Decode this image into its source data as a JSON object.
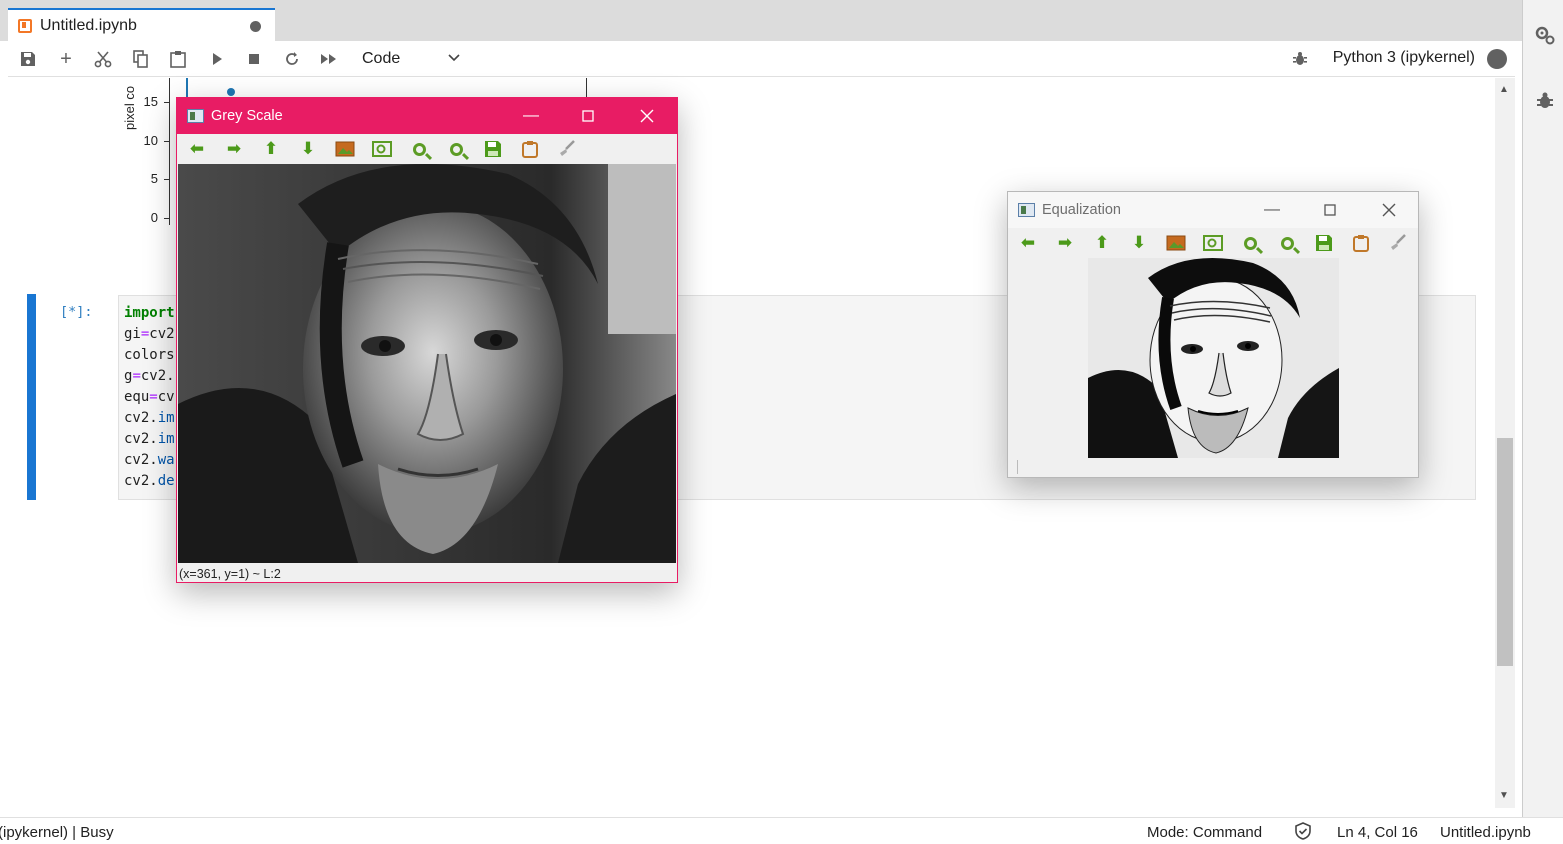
{
  "tab": {
    "title": "Untitled.ipynb"
  },
  "toolbar": {
    "cell_type": "Code",
    "kernel": "Python 3 (ipykernel)"
  },
  "plot": {
    "ylabel": "pixel co",
    "yticks": [
      "15",
      "10",
      "5",
      "0"
    ]
  },
  "cell": {
    "prompt": "[*]:",
    "lines": [
      {
        "kw": "import",
        "text": ""
      },
      {
        "a": "gi",
        "op": "=",
        "b": "cv2"
      },
      {
        "a": "colors",
        "op": "",
        "b": ""
      },
      {
        "a": "g",
        "op": "=",
        "b": "cv2."
      },
      {
        "a": "equ",
        "op": "=",
        "b": "cv"
      },
      {
        "a": "cv2.",
        "attr": "im"
      },
      {
        "a": "cv2.",
        "attr": "im"
      },
      {
        "a": "cv2.",
        "attr": "wa"
      },
      {
        "a": "cv2.",
        "attr": "de"
      }
    ]
  },
  "windows": {
    "grey": {
      "title": "Grey Scale",
      "status": "(x=361, y=1) ~ L:2"
    },
    "equalization": {
      "title": "Equalization"
    }
  },
  "statusbar": {
    "left": "(ipykernel) | Busy",
    "mode": "Mode: Command",
    "position": "Ln 4, Col 16",
    "filename": "Untitled.ipynb"
  },
  "colors": {
    "accent": "#1976d2",
    "grey_window": "#e81c64",
    "tool_green": "#4c9a1a"
  }
}
